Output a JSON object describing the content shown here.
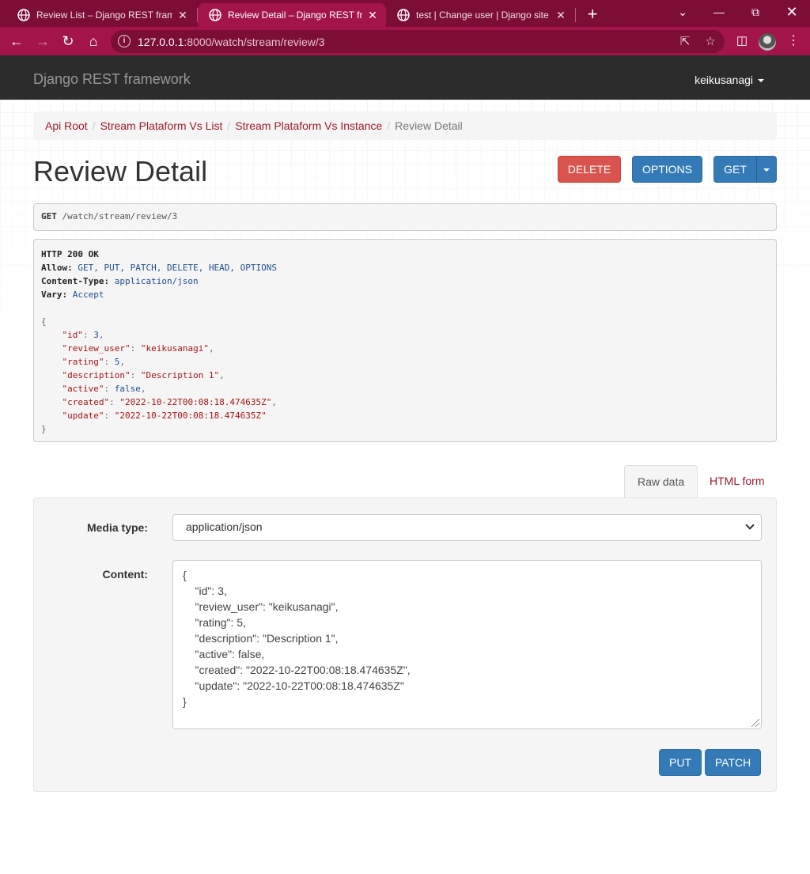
{
  "browser": {
    "tabs": [
      {
        "title": "Review List – Django REST framew",
        "close": "✕"
      },
      {
        "title": "Review Detail – Django REST fran",
        "close": "✕"
      },
      {
        "title": "test | Change user | Django site a",
        "close": "✕"
      }
    ],
    "new_tab": "+",
    "url_host": "127.0.0.1",
    "url_rest": ":8000/watch/stream/review/3"
  },
  "navbar": {
    "brand": "Django REST framework",
    "user": "keikusanagi"
  },
  "breadcrumb": {
    "items": [
      "Api Root",
      "Stream Plataform Vs List",
      "Stream Plataform Vs Instance"
    ],
    "current": "Review Detail"
  },
  "page": {
    "title": "Review Detail"
  },
  "actions": {
    "delete": "DELETE",
    "options": "OPTIONS",
    "get": "GET"
  },
  "request": {
    "method": "GET",
    "path": "/watch/stream/review/3"
  },
  "response": {
    "status": "HTTP 200 OK",
    "headers": [
      {
        "name": "Allow:",
        "value": "GET, PUT, PATCH, DELETE, HEAD, OPTIONS"
      },
      {
        "name": "Content-Type:",
        "value": "application/json"
      },
      {
        "name": "Vary:",
        "value": "Accept"
      }
    ],
    "body": {
      "id": 3,
      "review_user": "keikusanagi",
      "rating": 5,
      "description": "Description 1",
      "active": false,
      "created": "2022-10-22T00:08:18.474635Z",
      "update": "2022-10-22T00:08:18.474635Z"
    }
  },
  "form_tabs": {
    "raw": "Raw data",
    "html": "HTML form"
  },
  "form": {
    "media_type_label": "Media type:",
    "media_type_value": "application/json",
    "content_label": "Content:",
    "content_lines": [
      "{",
      "    \"id\": 3,",
      "    \"review_user\": \"keikusanagi\",",
      "    \"rating\": 5,",
      "    \"description\": \"Description 1\",",
      "    \"active\": false,",
      "    \"created\": \"2022-10-22T00:08:18.474635Z\",",
      "    \"update\": \"2022-10-22T00:08:18.474635Z\"",
      "}"
    ],
    "put": "PUT",
    "patch": "PATCH"
  },
  "colors": {
    "chrome": "#7b0d36",
    "chrome_active": "#a3154a",
    "link": "#9c1a2a",
    "danger": "#d9534f",
    "primary": "#337ab7"
  }
}
